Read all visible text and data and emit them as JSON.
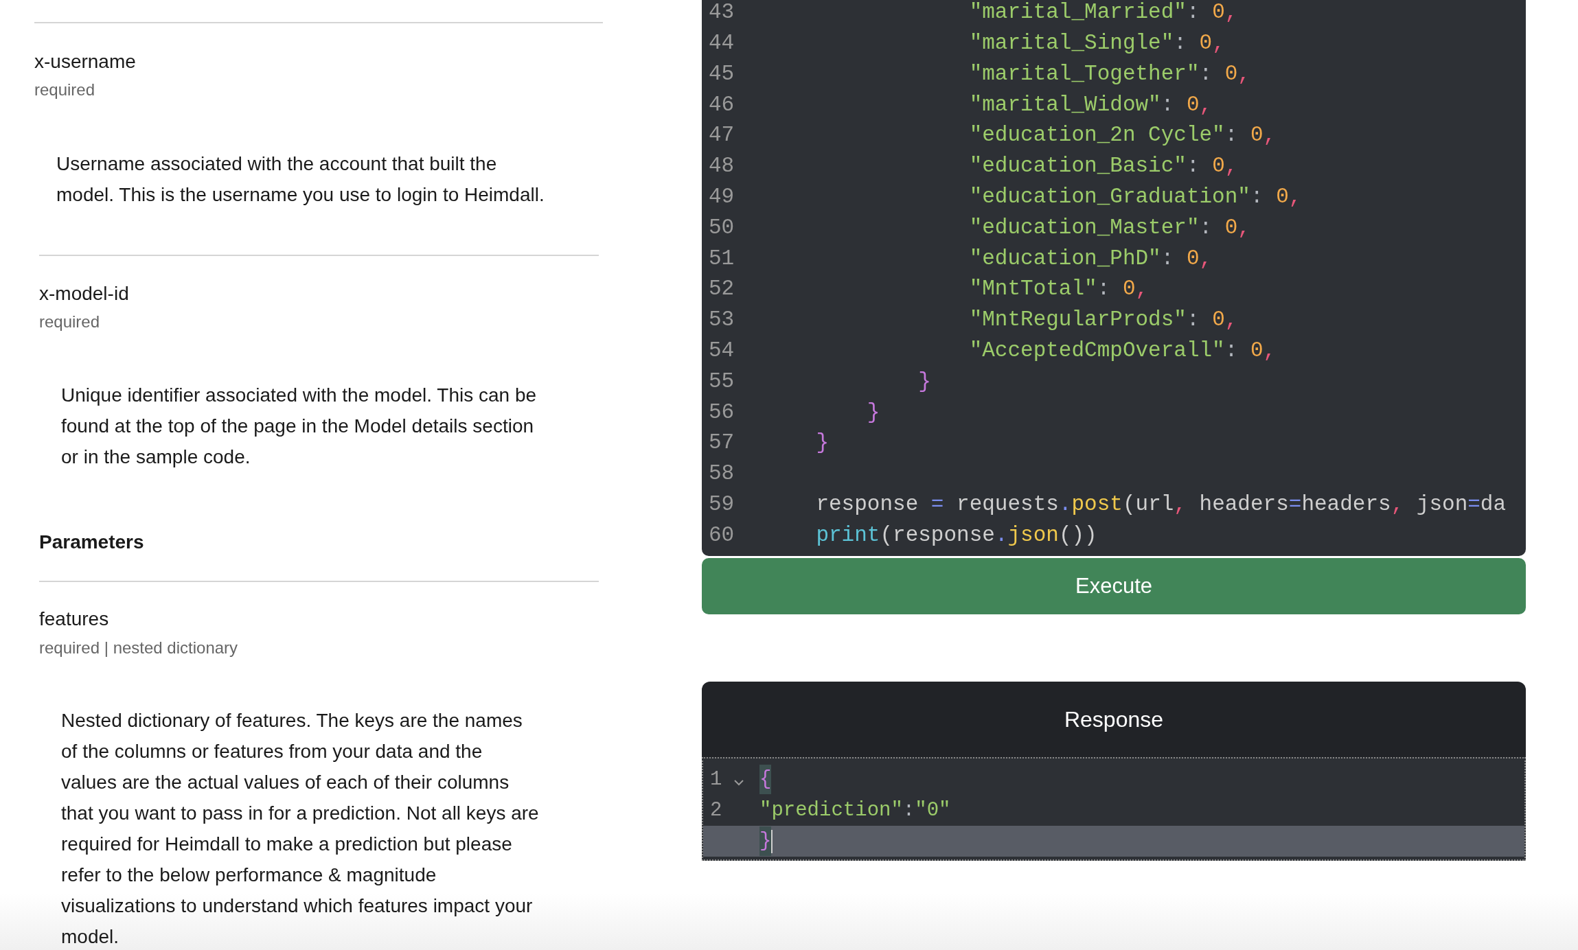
{
  "headers": [
    {
      "name": "x-username",
      "note": "required",
      "description": "Username associated with the account that built the\nmodel. This is the username you use to login to Heimdall."
    },
    {
      "name": "x-model-id",
      "note": "required",
      "description": "Unique identifier associated with the model. This can be\nfound at the top of the page in the Model details section\nor in the sample code."
    }
  ],
  "parameters_heading": "Parameters",
  "parameters": [
    {
      "name": "features",
      "note": "required | nested dictionary",
      "description": "Nested dictionary of features. The keys are the names\nof the columns or features from your data and the\nvalues are the actual values of each of their columns\nthat you want to pass in for a prediction. Not all keys are\nrequired for Heimdall to make a prediction but please\nrefer to the below performance & magnitude\nvisualizations to understand which features impact your\nmodel."
    }
  ],
  "code_editor": {
    "lines": [
      {
        "number": "43",
        "tokens": [
          {
            "kind": "string",
            "text": "                \"marital_Married\""
          },
          {
            "kind": "punct",
            "text": ": "
          },
          {
            "kind": "number",
            "text": "0"
          },
          {
            "kind": "comma",
            "text": ","
          }
        ]
      },
      {
        "number": "44",
        "tokens": [
          {
            "kind": "string",
            "text": "                \"marital_Single\""
          },
          {
            "kind": "punct",
            "text": ": "
          },
          {
            "kind": "number",
            "text": "0"
          },
          {
            "kind": "comma",
            "text": ","
          }
        ]
      },
      {
        "number": "45",
        "tokens": [
          {
            "kind": "string",
            "text": "                \"marital_Together\""
          },
          {
            "kind": "punct",
            "text": ": "
          },
          {
            "kind": "number",
            "text": "0"
          },
          {
            "kind": "comma",
            "text": ","
          }
        ]
      },
      {
        "number": "46",
        "tokens": [
          {
            "kind": "string",
            "text": "                \"marital_Widow\""
          },
          {
            "kind": "punct",
            "text": ": "
          },
          {
            "kind": "number",
            "text": "0"
          },
          {
            "kind": "comma",
            "text": ","
          }
        ]
      },
      {
        "number": "47",
        "tokens": [
          {
            "kind": "string",
            "text": "                \"education_2n Cycle\""
          },
          {
            "kind": "punct",
            "text": ": "
          },
          {
            "kind": "number",
            "text": "0"
          },
          {
            "kind": "comma",
            "text": ","
          }
        ]
      },
      {
        "number": "48",
        "tokens": [
          {
            "kind": "string",
            "text": "                \"education_Basic\""
          },
          {
            "kind": "punct",
            "text": ": "
          },
          {
            "kind": "number",
            "text": "0"
          },
          {
            "kind": "comma",
            "text": ","
          }
        ]
      },
      {
        "number": "49",
        "tokens": [
          {
            "kind": "string",
            "text": "                \"education_Graduation\""
          },
          {
            "kind": "punct",
            "text": ": "
          },
          {
            "kind": "number",
            "text": "0"
          },
          {
            "kind": "comma",
            "text": ","
          }
        ]
      },
      {
        "number": "50",
        "tokens": [
          {
            "kind": "string",
            "text": "                \"education_Master\""
          },
          {
            "kind": "punct",
            "text": ": "
          },
          {
            "kind": "number",
            "text": "0"
          },
          {
            "kind": "comma",
            "text": ","
          }
        ]
      },
      {
        "number": "51",
        "tokens": [
          {
            "kind": "string",
            "text": "                \"education_PhD\""
          },
          {
            "kind": "punct",
            "text": ": "
          },
          {
            "kind": "number",
            "text": "0"
          },
          {
            "kind": "comma",
            "text": ","
          }
        ]
      },
      {
        "number": "52",
        "tokens": [
          {
            "kind": "string",
            "text": "                \"MntTotal\""
          },
          {
            "kind": "punct",
            "text": ": "
          },
          {
            "kind": "number",
            "text": "0"
          },
          {
            "kind": "comma",
            "text": ","
          }
        ]
      },
      {
        "number": "53",
        "tokens": [
          {
            "kind": "string",
            "text": "                \"MntRegularProds\""
          },
          {
            "kind": "punct",
            "text": ": "
          },
          {
            "kind": "number",
            "text": "0"
          },
          {
            "kind": "comma",
            "text": ","
          }
        ]
      },
      {
        "number": "54",
        "tokens": [
          {
            "kind": "string",
            "text": "                \"AcceptedCmpOverall\""
          },
          {
            "kind": "punct",
            "text": ": "
          },
          {
            "kind": "number",
            "text": "0"
          },
          {
            "kind": "comma",
            "text": ","
          }
        ]
      },
      {
        "number": "55",
        "tokens": [
          {
            "kind": "brace",
            "text": "            }"
          }
        ]
      },
      {
        "number": "56",
        "tokens": [
          {
            "kind": "brace",
            "text": "        }"
          }
        ]
      },
      {
        "number": "57",
        "tokens": [
          {
            "kind": "brace",
            "text": "    }"
          }
        ]
      },
      {
        "number": "58"
      },
      {
        "number": "59",
        "tokens": [
          {
            "kind": "plain",
            "text": "    response "
          },
          {
            "kind": "operator",
            "text": "="
          },
          {
            "kind": "plain",
            "text": " requests"
          },
          {
            "kind": "operator",
            "text": "."
          },
          {
            "kind": "function",
            "text": "post"
          },
          {
            "kind": "plain",
            "text": "(url"
          },
          {
            "kind": "comma",
            "text": ","
          },
          {
            "kind": "plain",
            "text": " headers"
          },
          {
            "kind": "operator",
            "text": "="
          },
          {
            "kind": "plain",
            "text": "headers"
          },
          {
            "kind": "comma",
            "text": ","
          },
          {
            "kind": "plain",
            "text": " json"
          },
          {
            "kind": "operator",
            "text": "="
          },
          {
            "kind": "plain",
            "text": "da"
          }
        ]
      },
      {
        "number": "60",
        "tokens": [
          {
            "kind": "builtin",
            "text": "    print"
          },
          {
            "kind": "plain",
            "text": "(response"
          },
          {
            "kind": "operator",
            "text": "."
          },
          {
            "kind": "function",
            "text": "json"
          },
          {
            "kind": "plain",
            "text": "())"
          }
        ]
      }
    ]
  },
  "execute_button": "Execute",
  "response": {
    "title": "Response",
    "lines": [
      {
        "number": "1",
        "foldable": true,
        "active": false,
        "cursor": false,
        "tokens": [
          {
            "kind": "brace",
            "text": "{",
            "matched": true
          }
        ]
      },
      {
        "number": "2",
        "foldable": false,
        "active": false,
        "cursor": false,
        "tokens": [
          {
            "kind": "string",
            "text": "\"prediction\"",
            "matched": false
          },
          {
            "kind": "punct",
            "text": ":",
            "matched": false
          },
          {
            "kind": "string",
            "text": "\"0\"",
            "matched": false
          }
        ]
      },
      {
        "foldable": false,
        "active": true,
        "cursor": true,
        "tokens": [
          {
            "kind": "brace",
            "text": "}",
            "matched": true
          }
        ]
      }
    ]
  }
}
